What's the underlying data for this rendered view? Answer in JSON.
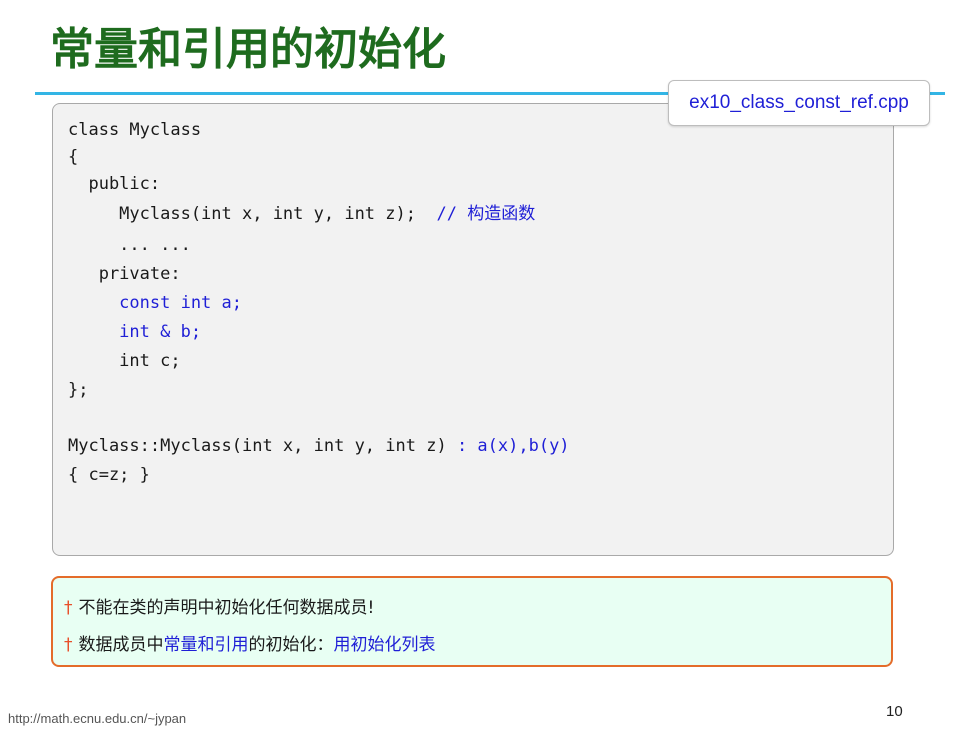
{
  "slide": {
    "title": "常量和引用的初始化",
    "filename": "ex10_class_const_ref.cpp",
    "page_number": "10",
    "footer_url": "http://math.ecnu.edu.cn/~jypan"
  },
  "code": {
    "l1": "class Myclass",
    "l2": "{",
    "l3": "  public:",
    "l4": "     Myclass(int x, int y, int z);",
    "l4_comment": "// 构造函数",
    "l5": "     ... ...",
    "l6": "   private:",
    "l7": "     const int a;",
    "l8": "     int & b;",
    "l9": "     int c;",
    "l10": "};",
    "l11": "Myclass::Myclass(int x, int y, int z)",
    "l11_init": ": a(x),b(y)",
    "l12": "{ c=z; }"
  },
  "notes": {
    "bullet": "†",
    "n1": "不能在类的声明中初始化任何数据成员!",
    "n2_a": "数据成员中",
    "n2_b": "常量和引用",
    "n2_c": "的初始化：",
    "n2_d": "用初始化列表"
  },
  "colors": {
    "title": "#1e6b1e",
    "rule": "#33b5e5",
    "code_highlight": "#1f1fd6",
    "note_border": "#e46c2a",
    "note_background": "#e8fff3",
    "code_background": "#f2f2f2"
  }
}
